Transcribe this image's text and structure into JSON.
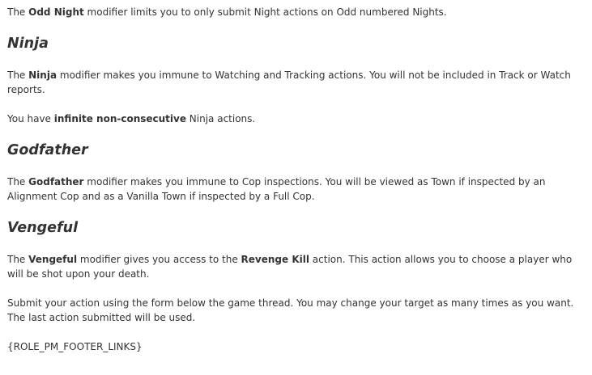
{
  "odd_night": {
    "p1_pre": "The ",
    "p1_bold": "Odd Night",
    "p1_post": " modifier limits you to only submit Night actions on Odd numbered Nights."
  },
  "ninja": {
    "heading": "Ninja",
    "p1_pre": "The ",
    "p1_bold": "Ninja",
    "p1_post": " modifier makes you immune to Watching and Tracking actions. You will not be included in Track or Watch reports.",
    "p2_pre": "You have ",
    "p2_bold": "infinite non-consecutive",
    "p2_post": " Ninja actions."
  },
  "godfather": {
    "heading": "Godfather",
    "p1_pre": "The ",
    "p1_bold": "Godfather",
    "p1_post": " modifier makes you immune to Cop inspections. You will be viewed as Town if inspected by an Alignment Cop and as a Vanilla Town if inspected by a Full Cop."
  },
  "vengeful": {
    "heading": "Vengeful",
    "p1_pre": "The ",
    "p1_bold": "Vengeful",
    "p1_mid": " modifier gives you access to the ",
    "p1_bold2": "Revenge Kill",
    "p1_post": " action. This action allows you to choose a player who will be shot upon your death."
  },
  "submit_note": "Submit your action using the form below the game thread. You may change your target as many times as you want. The last action submitted will be used.",
  "footer_placeholder": "{ROLE_PM_FOOTER_LINKS}"
}
